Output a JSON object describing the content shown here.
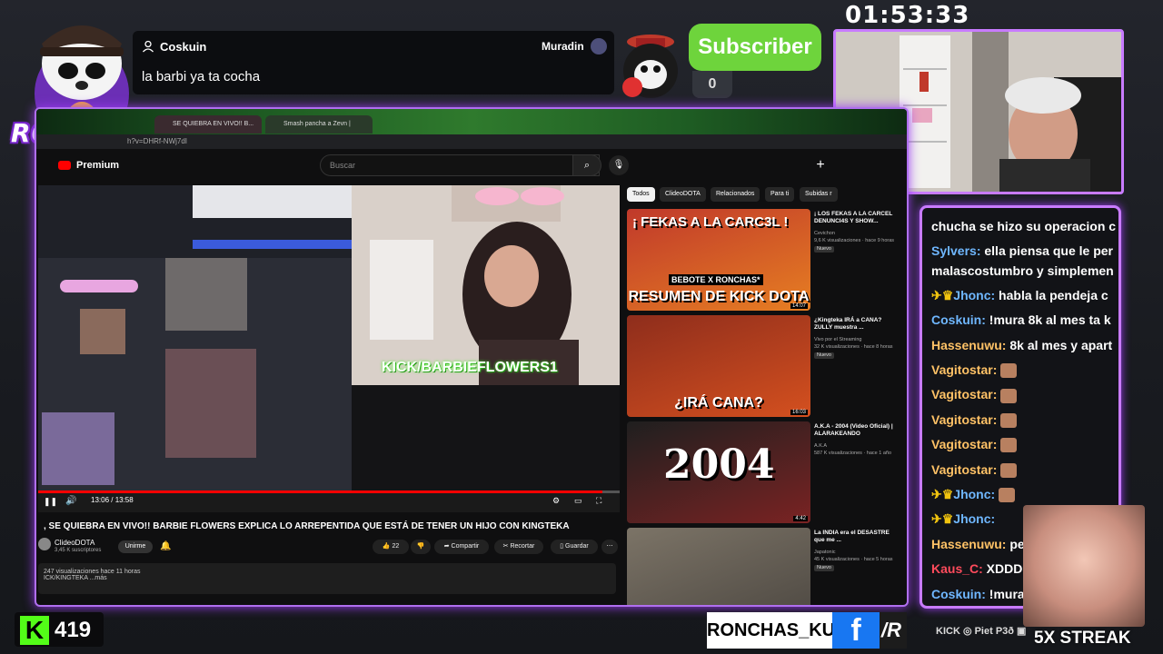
{
  "logo": {
    "text": "RONCHAS"
  },
  "clock": "01:53:33",
  "chat_popup": {
    "username": "Coskuin",
    "message": "la barbi ya ta cocha",
    "right_name": "Muradin"
  },
  "subscriber": {
    "label": "Subscriber",
    "count": "0"
  },
  "browser": {
    "tabs": [
      "SE QUIEBRA EN VIVO!! B...",
      "Smash pancha a Zevn | Kingtek..."
    ],
    "url": "h?v=DHRf-NWj7dI",
    "brand": "Premium",
    "search_placeholder": "Buscar"
  },
  "video": {
    "overlay_text": "KICK/BARBIEFLOWERS1",
    "time": "13:06 / 13:58",
    "progress": 0.97,
    "title": ", SE QUIEBRA EN VIVO!! BARBIE FLOWERS EXPLICA LO ARREPENTIDA QUE ESTÁ DE TENER UN HIJO CON KINGTEKA",
    "channel": "ClideoDOTA",
    "subscribers": "3,45 K suscriptores",
    "join_label": "Unirme",
    "likes": "22",
    "share_label": "Compartir",
    "clip_label": "Recortar",
    "save_label": "Guardar",
    "desc_stats": "247 visualizaciones  hace 11 horas",
    "desc_text": "ICK/KINGTEKA ...más"
  },
  "rec_chips": [
    "Todos",
    "ClideoDOTA",
    "Relacionados",
    "Para ti",
    "Subidas r"
  ],
  "recommendations": [
    {
      "thumb_top": "¡ FEKAS A LA CARC3L !",
      "thumb_bottom": "RESUMEN DE KICK DOTA",
      "thumb_mid": "BEBOTE X RONCHAS*",
      "duration": "14:07",
      "title": "¡ LOS FEKAS A LA CARCEL DENUNCI4S Y SHOW...",
      "channel": "Cevichon",
      "meta": "9,6 K visualizaciones · hace 9 horas",
      "badge": "Nuevo",
      "colors": [
        "#c0392b",
        "#e67e22"
      ]
    },
    {
      "thumb_top": "",
      "thumb_bottom": "¿IRÁ CANA?",
      "thumb_mid": "",
      "duration": "16:03",
      "title": "¿Kingteka IRÁ a CANA? ZULLY muestra ...",
      "channel": "Vivo por el Streaming",
      "meta": "32 K visualizaciones · hace 8 horas",
      "badge": "Nuevo",
      "colors": [
        "#8e2d1c",
        "#d4501f"
      ]
    },
    {
      "thumb_top": "",
      "thumb_bottom": "",
      "thumb_mid": "2004",
      "duration": "4:42",
      "title": "A.K.A - 2004 (Video Oficial) | ALARAKEANDO",
      "channel": "A.K.A",
      "meta": "587 K visualizaciones · hace 1 año",
      "badge": "",
      "colors": [
        "#1f1f1f",
        "#7a2323"
      ]
    },
    {
      "thumb_top": "",
      "thumb_bottom": "",
      "thumb_mid": "",
      "duration": "",
      "title": "La INDIA era el DESASTRE que me ...",
      "channel": "Japatonic",
      "meta": "45 K visualizaciones · hace 5 horas",
      "badge": "Nuevo",
      "colors": [
        "#7c7467",
        "#4b4640"
      ]
    }
  ],
  "chat": [
    {
      "user": "",
      "text": "chucha se hizo su operacion c",
      "color": "white"
    },
    {
      "user": "Sylvers:",
      "text": " ella piensa que le per",
      "color": "blue",
      "wrap": "malascostumbro y simplemen"
    },
    {
      "user": "Jhonc:",
      "text": " habla la pendeja c",
      "color": "blue",
      "badge": true
    },
    {
      "user": "Coskuin:",
      "text": " !mura 8k al mes ta k",
      "color": "blue"
    },
    {
      "user": "Hassenuwu:",
      "text": " 8k al mes y apart",
      "color": "orange"
    },
    {
      "user": "Vagitostar:",
      "text": "",
      "color": "orange",
      "emote": true
    },
    {
      "user": "Vagitostar:",
      "text": "",
      "color": "orange",
      "emote": true
    },
    {
      "user": "Vagitostar:",
      "text": "",
      "color": "orange",
      "emote": true
    },
    {
      "user": "Vagitostar:",
      "text": "",
      "color": "orange",
      "emote": true
    },
    {
      "user": "Vagitostar:",
      "text": "",
      "color": "orange",
      "emote": true
    },
    {
      "user": "Jhonc:",
      "text": "",
      "color": "blue",
      "badge": true,
      "emote": true
    },
    {
      "user": "Jhonc:",
      "text": "",
      "color": "blue",
      "badge": true
    },
    {
      "user": "Hassenuwu:",
      "text": " pe",
      "color": "orange"
    },
    {
      "user": "Kaus_C:",
      "text": " XDDD",
      "color": "red"
    },
    {
      "user": "Coskuin:",
      "text": " !mura",
      "color": "blue"
    }
  ],
  "bottom": {
    "kick_followers": "419",
    "handle": "RONCHAS_KUN",
    "fb": "f",
    "r": "/R",
    "socials": "KICK  ◎  Piet  P3ð  ▣",
    "streak": "5X STREAK"
  },
  "colors": {
    "accent": "#b06ff0",
    "kick_green": "#53fc18",
    "sub_green": "#6ed43c"
  }
}
